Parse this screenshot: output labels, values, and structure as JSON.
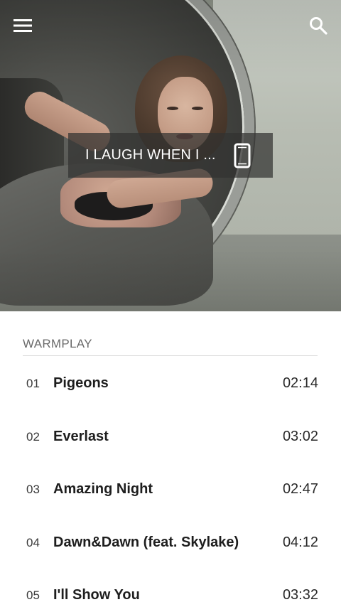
{
  "toolbar": {
    "menu_icon": "hamburger-menu-icon",
    "search_icon": "search-icon"
  },
  "now_playing": {
    "title": "I LAUGH WHEN I ...",
    "device_icon": "smartphone-icon"
  },
  "album": {
    "name": "WARMPLAY"
  },
  "tracks": [
    {
      "number": "01",
      "title": "Pigeons",
      "duration": "02:14"
    },
    {
      "number": "02",
      "title": "Everlast",
      "duration": "03:02"
    },
    {
      "number": "03",
      "title": "Amazing Night",
      "duration": "02:47"
    },
    {
      "number": "04",
      "title": "Dawn&Dawn (feat. Skylake)",
      "duration": "04:12"
    },
    {
      "number": "05",
      "title": "I'll Show You",
      "duration": "03:32"
    }
  ]
}
